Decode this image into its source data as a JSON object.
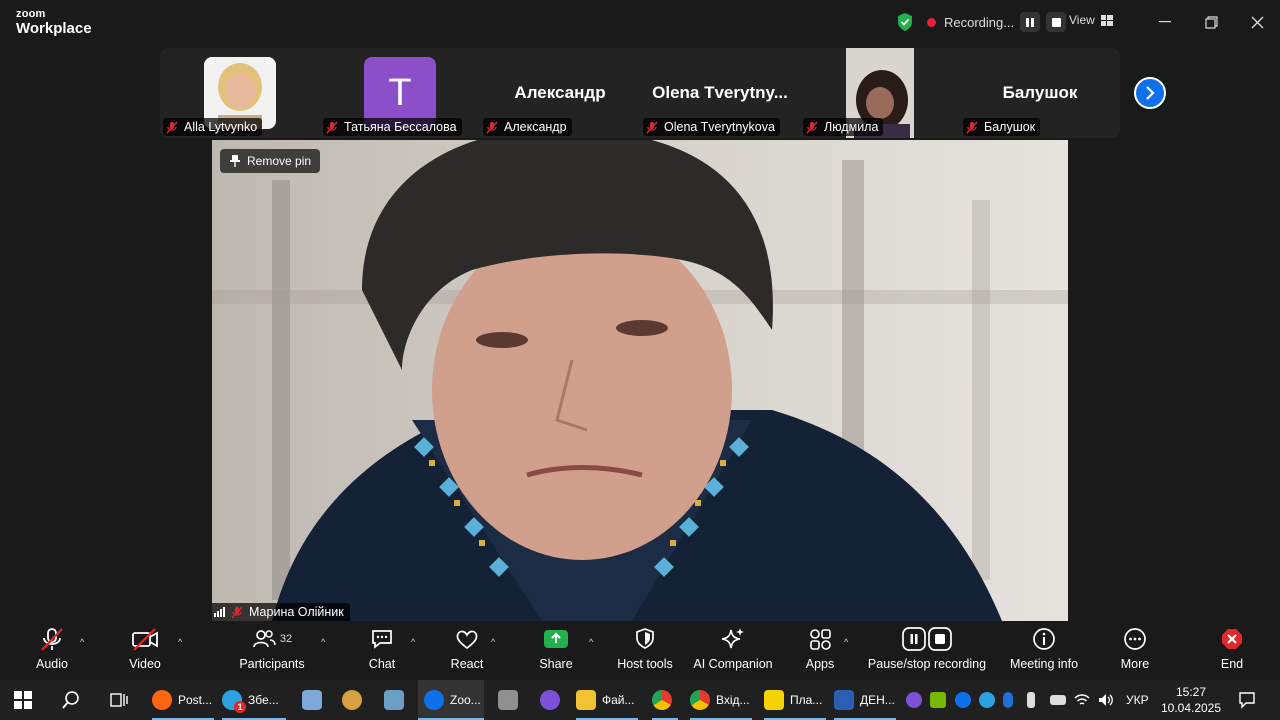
{
  "app": {
    "brand_top": "zoom",
    "brand_bottom": "Workplace",
    "recording_text": "Recording...",
    "view_label": "View"
  },
  "strip": {
    "participants": [
      {
        "display": "photo",
        "label": "Alla Lytvynko",
        "muted": true
      },
      {
        "display": "letter",
        "letter": "T",
        "label": "Татьяна Бессалова",
        "muted": true
      },
      {
        "display": "name",
        "big_name": "Александр",
        "label": "Александр",
        "muted": true
      },
      {
        "display": "name",
        "big_name": "Olena  Tverytny...",
        "label": "Olena Tverytnykova",
        "muted": true
      },
      {
        "display": "photo",
        "label": "Людмила",
        "muted": true
      },
      {
        "display": "name",
        "big_name": "Балушок",
        "label": "Балушок",
        "muted": true
      }
    ]
  },
  "main": {
    "remove_pin_label": "Remove pin",
    "speaker_name": "Марина Олійник"
  },
  "toolbar": {
    "audio": "Audio",
    "video": "Video",
    "participants": "Participants",
    "participants_count": "32",
    "chat": "Chat",
    "react": "React",
    "share": "Share",
    "host_tools": "Host tools",
    "ai_companion": "AI Companion",
    "apps": "Apps",
    "pause_stop": "Pause/stop recording",
    "meeting_info": "Meeting info",
    "more": "More",
    "end": "End"
  },
  "taskbar": {
    "apps": [
      {
        "label": "Post...",
        "color": "#ff6611"
      },
      {
        "label": "Збе...",
        "color": "#2aa3e0",
        "badge": "1"
      },
      {
        "label": "",
        "color": "#7fa8d8"
      },
      {
        "label": "",
        "color": "#d8a040"
      },
      {
        "label": "",
        "color": "#6aa0c8"
      },
      {
        "label": "Zoo...",
        "color": "#0e71eb"
      },
      {
        "label": "",
        "color": "#909090"
      },
      {
        "label": "",
        "color": "#7d50d8"
      },
      {
        "label": "Фай...",
        "color": "#f2c233"
      },
      {
        "label": "",
        "color": "#e53b2f"
      },
      {
        "label": "Вхід...",
        "color": "#e53b2f"
      },
      {
        "label": "Пла...",
        "color": "#f5d300"
      },
      {
        "label": "ДЕН...",
        "color": "#2b5fb4"
      }
    ],
    "language": "УКР",
    "time": "15:27",
    "date": "10.04.2025"
  }
}
